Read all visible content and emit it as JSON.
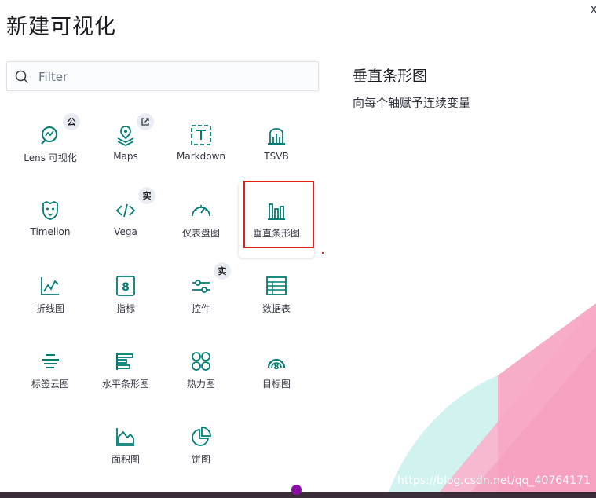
{
  "header": {
    "title": "新建可视化",
    "close_label": "x"
  },
  "search": {
    "placeholder": "Filter"
  },
  "tiles": [
    {
      "label": "Lens 可视化",
      "icon": "lens-icon",
      "badge": "公"
    },
    {
      "label": "Maps",
      "icon": "maps-icon",
      "badge": "external-link-icon"
    },
    {
      "label": "Markdown",
      "icon": "markdown-icon"
    },
    {
      "label": "TSVB",
      "icon": "tsvb-icon"
    },
    {
      "label": "Timelion",
      "icon": "timelion-icon"
    },
    {
      "label": "Vega",
      "icon": "vega-icon",
      "badge": "实"
    },
    {
      "label": "仪表盘图",
      "icon": "gauge-icon"
    },
    {
      "label": "垂直条形图",
      "icon": "vertical-bar-icon",
      "selected": true
    },
    {
      "label": "折线图",
      "icon": "line-chart-icon"
    },
    {
      "label": "指标",
      "icon": "metric-icon"
    },
    {
      "label": "控件",
      "icon": "controls-icon",
      "badge": "实"
    },
    {
      "label": "数据表",
      "icon": "data-table-icon"
    },
    {
      "label": "标签云图",
      "icon": "tag-cloud-icon"
    },
    {
      "label": "水平条形图",
      "icon": "horizontal-bar-icon"
    },
    {
      "label": "热力图",
      "icon": "heatmap-icon"
    },
    {
      "label": "目标图",
      "icon": "goal-icon"
    },
    {
      "label": "面积图",
      "icon": "area-chart-icon"
    },
    {
      "label": "饼图",
      "icon": "pie-chart-icon"
    }
  ],
  "description": {
    "title": "垂直条形图",
    "text": "向每个轴赋予连续变量"
  },
  "watermark": "https://blog.csdn.net/qq_40764171",
  "colors": {
    "icon": "#017d73",
    "highlight": "#e0201c",
    "accent_pink": "#f7a8c4",
    "accent_teal": "#bfeee8"
  }
}
